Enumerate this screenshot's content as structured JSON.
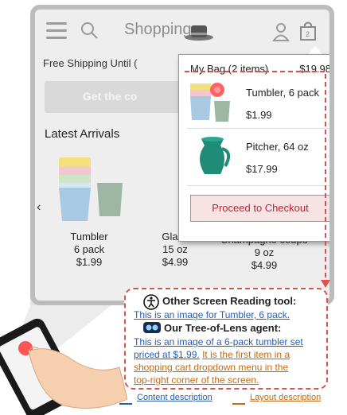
{
  "header": {
    "title": "Shopping"
  },
  "shipping_text": "Free Shipping Until (",
  "promo_button": "Get the co",
  "section_title": "Latest Arrivals",
  "arrows": {
    "left": "‹",
    "right": "›"
  },
  "products": [
    {
      "name": "Tumbler",
      "size": "6 pack",
      "price": "$1.99"
    },
    {
      "name": "Glass",
      "size": "15 oz",
      "price": "$4.99"
    },
    {
      "name": "Champagne coupe",
      "size": "9 oz",
      "price": "$4.99"
    }
  ],
  "cart": {
    "header": "My Bag (2 items)",
    "total": "$19.98",
    "items": [
      {
        "name": "Tumbler, 6 pack",
        "price": "$1.99"
      },
      {
        "name": "Pitcher, 64 oz",
        "price": "$17.99"
      }
    ],
    "checkout_label": "Proceed to Checkout"
  },
  "callout": {
    "tool1_title": "Other Screen Reading tool:",
    "tool1_text": "This is an image for Tumbler, 6 pack.",
    "tool2_title": "Our Tree-of-Lens agent:",
    "tool2_content_1": "This is an image of a 6-pack tumbler set",
    "tool2_content_2": "priced at $1.99.",
    "tool2_layout_1": "It is the first item in a",
    "tool2_layout_2": "shopping cart dropdown menu in the",
    "tool2_layout_3": "top-right corner of the screen."
  },
  "legend": {
    "content": "Content description",
    "layout": "Layout description"
  },
  "colors": {
    "accent_red": "#d9534f",
    "content_blue": "#2a5db0",
    "layout_orange": "#c26a14"
  }
}
